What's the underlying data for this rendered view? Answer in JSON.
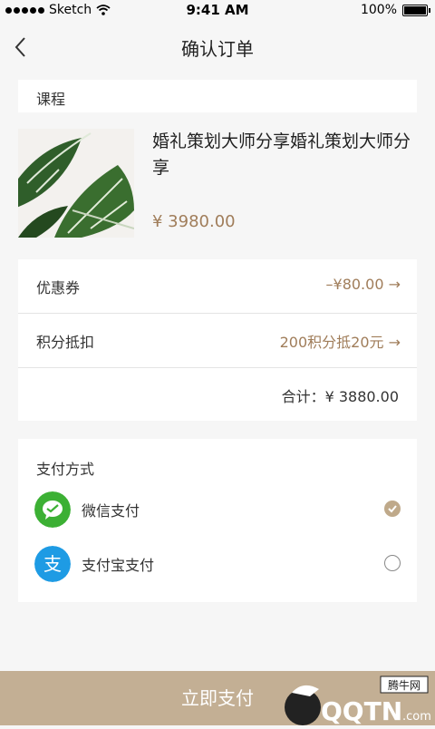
{
  "status_bar": {
    "carrier": "Sketch",
    "time": "9:41 AM",
    "battery": "100%"
  },
  "nav": {
    "title": "确认订单"
  },
  "course": {
    "section_label": "课程",
    "name": "婚礼策划大师分享婚礼策划大师分享",
    "price": "¥ 3980.00"
  },
  "discounts": {
    "coupon_label": "优惠券",
    "coupon_value": "–¥80.00 →",
    "points_label": "积分抵扣",
    "points_value": "200积分抵20元 →",
    "total": "合计：¥ 3880.00"
  },
  "payment": {
    "title": "支付方式",
    "options": [
      {
        "label": "微信支付",
        "icon": "wechat-pay-icon",
        "selected": true
      },
      {
        "label": "支付宝支付",
        "icon": "alipay-icon",
        "selected": false
      }
    ]
  },
  "pay_button": {
    "label": "立即支付"
  },
  "watermark": {
    "text": "QQTN.com",
    "sub": "腾牛网"
  },
  "colors": {
    "accent": "#a07d5a",
    "button": "#c3af94",
    "wechat": "#3cb034",
    "alipay": "#1e9be4"
  }
}
